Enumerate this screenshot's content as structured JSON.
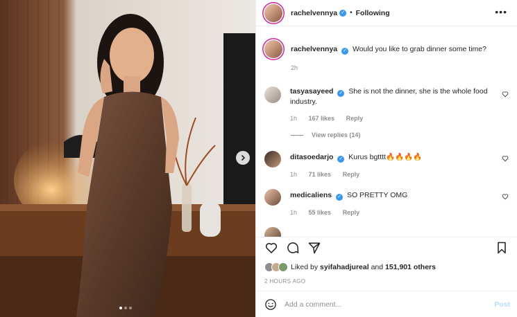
{
  "header": {
    "username": "rachelvennya",
    "separator": "•",
    "follow_status": "Following",
    "more_icon": "more-horizontal-icon"
  },
  "caption": {
    "username": "rachelvennya",
    "text": "Would you like to grab dinner some time?",
    "time": "2h"
  },
  "comments": [
    {
      "username": "tasyasayeed",
      "text": "She is not the dinner, she is the whole food industry.",
      "time": "1h",
      "likes": "167 likes",
      "reply": "Reply",
      "view_replies": "View replies (14)"
    },
    {
      "username": "ditasoedarjo",
      "text": "Kurus bgtttt🔥🔥🔥🔥",
      "time": "1h",
      "likes": "71 likes",
      "reply": "Reply"
    },
    {
      "username": "medicaliens",
      "text": "SO PRETTY OMG",
      "time": "1h",
      "likes": "55 likes",
      "reply": "Reply"
    }
  ],
  "likes": {
    "prefix": "Liked by ",
    "user": "syifahadjureal",
    "middle": " and ",
    "count": "151,901 others"
  },
  "time_ago": "2 HOURS AGO",
  "add_comment": {
    "placeholder": "Add a comment...",
    "post_label": "Post"
  },
  "carousel": {
    "slides": 3,
    "active_index": 0
  },
  "colors": {
    "verified": "#3897f0",
    "post_disabled": "#b2dffc",
    "secondary_text": "#8e8e8e",
    "story_ring": "#d6249f"
  }
}
